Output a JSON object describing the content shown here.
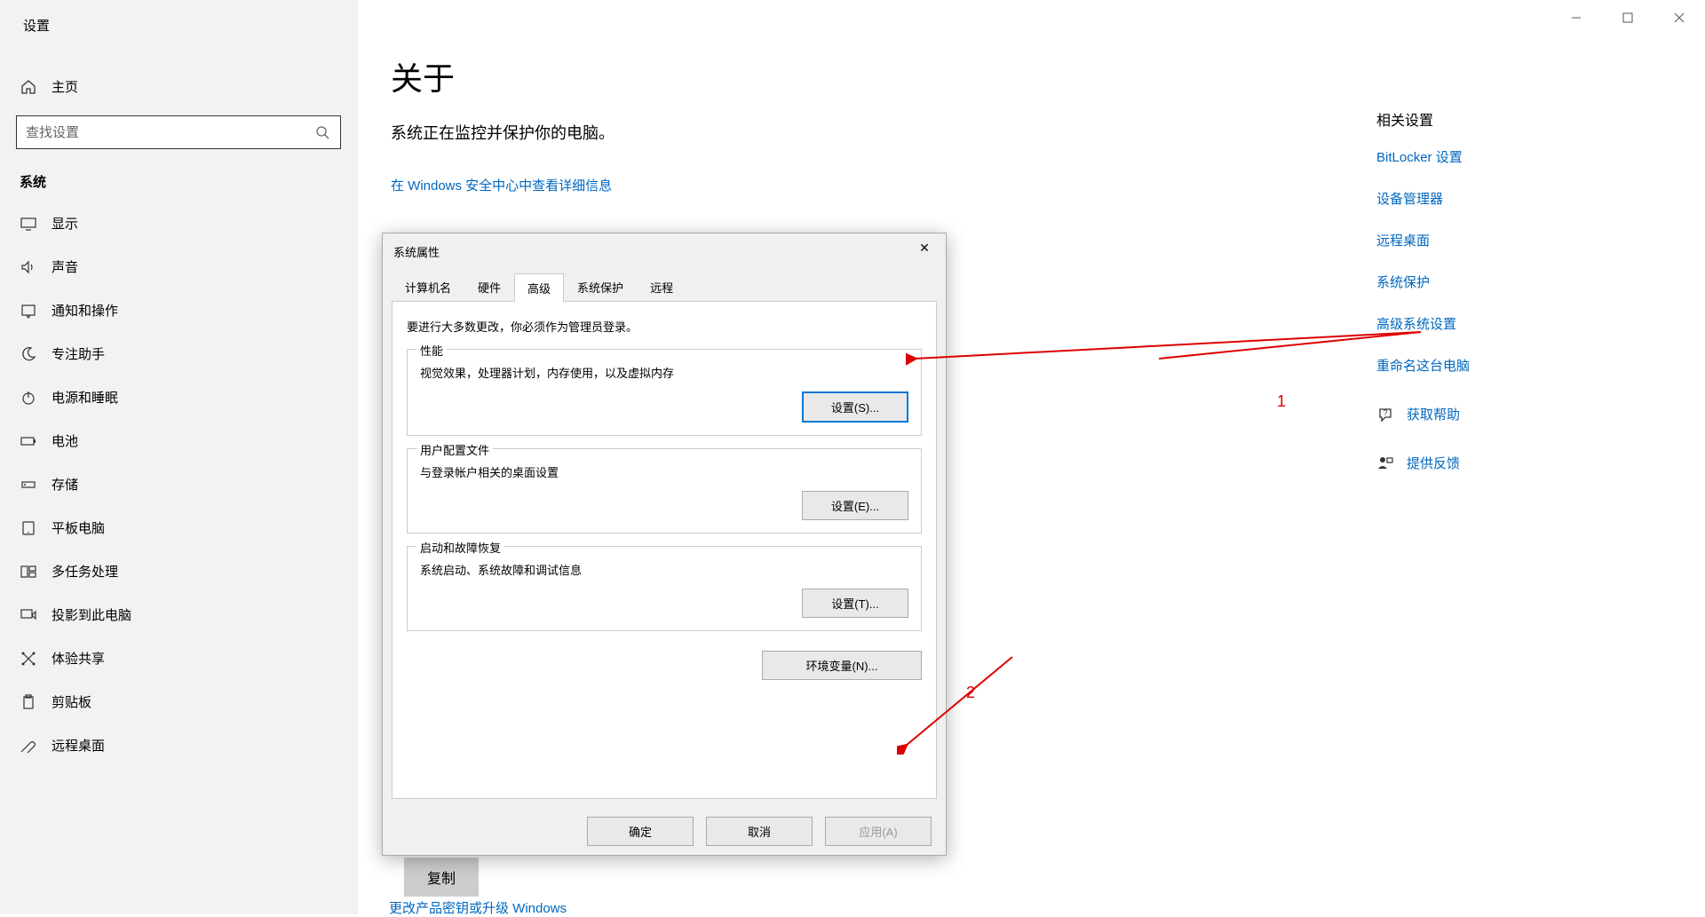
{
  "window": {
    "title": "设置"
  },
  "sidebar": {
    "home": "主页",
    "search_placeholder": "查找设置",
    "section": "系统",
    "items": [
      {
        "label": "显示"
      },
      {
        "label": "声音"
      },
      {
        "label": "通知和操作"
      },
      {
        "label": "专注助手"
      },
      {
        "label": "电源和睡眠"
      },
      {
        "label": "电池"
      },
      {
        "label": "存储"
      },
      {
        "label": "平板电脑"
      },
      {
        "label": "多任务处理"
      },
      {
        "label": "投影到此电脑"
      },
      {
        "label": "体验共享"
      },
      {
        "label": "剪贴板"
      },
      {
        "label": "远程桌面"
      }
    ]
  },
  "main": {
    "title": "关于",
    "protect": "系统正在监控并保护你的电脑。",
    "security_link": "在 Windows 安全中心中查看详细信息",
    "copy": "复制",
    "product_link": "更改产品密钥或升级 Windows"
  },
  "right": {
    "title": "相关设置",
    "links": [
      "BitLocker 设置",
      "设备管理器",
      "远程桌面",
      "系统保护",
      "高级系统设置",
      "重命名这台电脑"
    ],
    "help": "获取帮助",
    "feedback": "提供反馈"
  },
  "dialog": {
    "title": "系统属性",
    "tabs": [
      "计算机名",
      "硬件",
      "高级",
      "系统保护",
      "远程"
    ],
    "active_tab": 2,
    "admin_note": "要进行大多数更改，你必须作为管理员登录。",
    "groups": [
      {
        "title": "性能",
        "desc": "视觉效果，处理器计划，内存使用，以及虚拟内存",
        "btn": "设置(S)..."
      },
      {
        "title": "用户配置文件",
        "desc": "与登录帐户相关的桌面设置",
        "btn": "设置(E)..."
      },
      {
        "title": "启动和故障恢复",
        "desc": "系统启动、系统故障和调试信息",
        "btn": "设置(T)..."
      }
    ],
    "env_btn": "环境变量(N)...",
    "footer": {
      "ok": "确定",
      "cancel": "取消",
      "apply": "应用(A)"
    }
  },
  "annotations": {
    "arrow1": "1",
    "arrow2": "2"
  }
}
